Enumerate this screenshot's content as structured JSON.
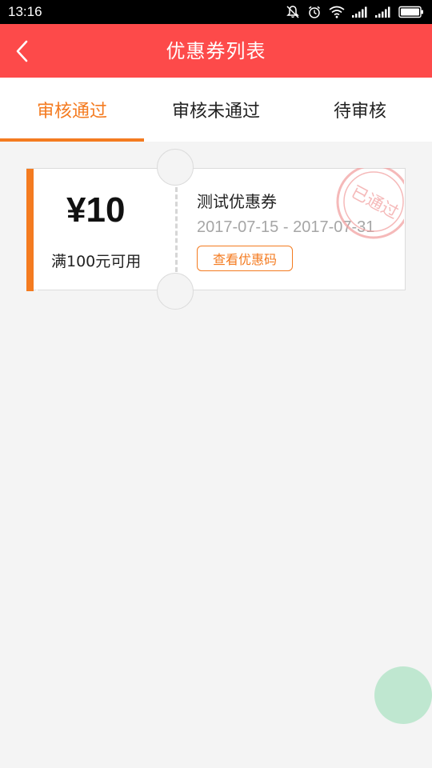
{
  "status_bar": {
    "time": "13:16",
    "icons": [
      "muted-bell-icon",
      "alarm-icon",
      "wifi-icon",
      "signal-icon",
      "signal-icon",
      "battery-icon"
    ]
  },
  "header": {
    "title": "优惠券列表",
    "back_icon": "chevron-left-icon",
    "background_color": "#fd4a4a"
  },
  "tabs": [
    {
      "label": "审核通过",
      "active": true
    },
    {
      "label": "审核未通过",
      "active": false
    },
    {
      "label": "待审核",
      "active": false
    }
  ],
  "accent_color": "#f47b20",
  "coupons": [
    {
      "amount": "¥10",
      "condition": "满100元可用",
      "name": "测试优惠券",
      "date_range": "2017-07-15 - 2017-07-31",
      "action_label": "查看优惠码",
      "stamp_text": "已通过",
      "stamp_color": "#f2a2a2"
    }
  ],
  "fab": {
    "color": "#b9e6cc"
  }
}
